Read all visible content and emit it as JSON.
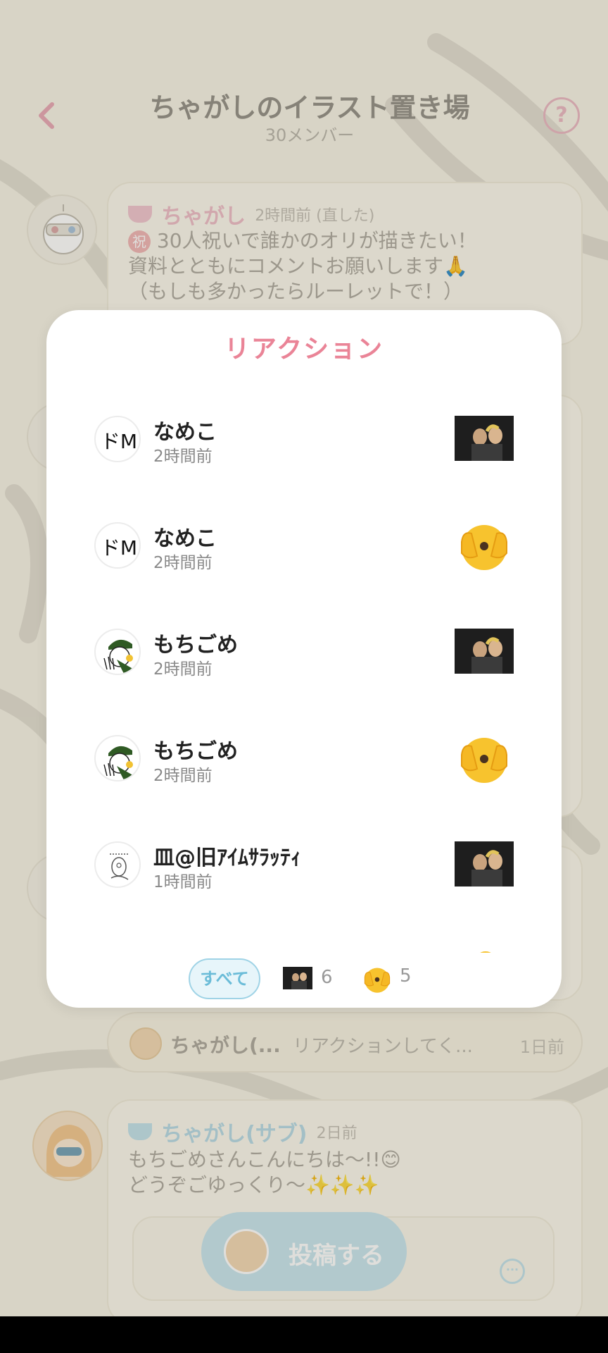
{
  "header": {
    "back_icon": "chevron-left-icon",
    "title": "ちゃがしのイラスト置き場",
    "subtitle": "30メンバー",
    "help_icon": "help-icon",
    "help_label": "?"
  },
  "background_posts": [
    {
      "name": "ちゃがし",
      "time": "2時間前 (直した)",
      "badge": "祝",
      "lines": [
        "30人祝いで誰かのオリが描きたい！",
        "資料とともにコメントお願いします🙏",
        "（もしも多かったらルーレットで！）"
      ]
    },
    {
      "name": "ちゃがし(サブ)",
      "time": "2日前",
      "lines": [
        "もちごめさんこんにちは〜!!😊",
        "どうぞごゆっくり〜✨✨✨"
      ]
    }
  ],
  "reply": {
    "name": "ちゃがし(...",
    "text": "リアクションしてく...",
    "time": "1日前"
  },
  "post_button": {
    "label": "投稿する"
  },
  "modal": {
    "title": "リアクション",
    "reactions": [
      {
        "name": "なめこ",
        "time": "2時間前",
        "avatar_text": "ドM",
        "reaction": "photo"
      },
      {
        "name": "なめこ",
        "time": "2時間前",
        "avatar_text": "ドM",
        "reaction": "face-with-peeking-eye"
      },
      {
        "name": "もちごめ",
        "time": "2時間前",
        "reaction": "photo"
      },
      {
        "name": "もちごめ",
        "time": "2時間前",
        "reaction": "face-with-peeking-eye"
      },
      {
        "name": "皿@旧ｱｲﾑｻﾗｯﾃｨ",
        "time": "1時間前",
        "reaction": "photo"
      }
    ],
    "filters": {
      "all_label": "すべて",
      "photo_count": "6",
      "emoji_count": "5"
    }
  },
  "colors": {
    "accent_pink": "#ea8497",
    "accent_blue": "#6bbcd8",
    "background": "#f7f3e5"
  }
}
